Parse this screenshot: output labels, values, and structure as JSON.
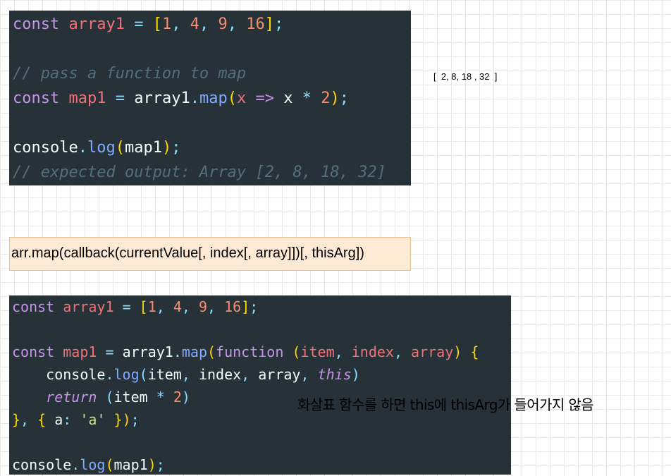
{
  "code_block_1": {
    "lines": [
      "const array1 = [1, 4, 9, 16];",
      "",
      "// pass a function to map",
      "const map1 = array1.map(x => x * 2);",
      "",
      "console.log(map1);",
      "// expected output: Array [2, 8, 18, 32]"
    ]
  },
  "result_output": "[  2, 8, 18 , 32  ]",
  "syntax_box": "arr.map(callback(currentValue[, index[, array]])[, thisArg])",
  "code_block_2": {
    "lines": [
      "const array1 = [1, 4, 9, 16];",
      "",
      "const map1 = array1.map(function (item, index, array) {",
      "    console.log(item, index, array, this)",
      "    return (item * 2)",
      "}, { a: 'a' });",
      "",
      "console.log(map1);"
    ]
  },
  "note": "화살표 함수를 하면 this에 thisArg가 들어가지 않음",
  "colors": {
    "code_background": "#263238",
    "keyword": "#c792ea",
    "variable": "#f07178",
    "number": "#f78c6c",
    "bracket": "#ffd700",
    "punctuation": "#89ddff",
    "function": "#82aaff",
    "comment": "#546e7a",
    "string": "#c3e88d",
    "syntax_box_background": "#fde9d4"
  }
}
